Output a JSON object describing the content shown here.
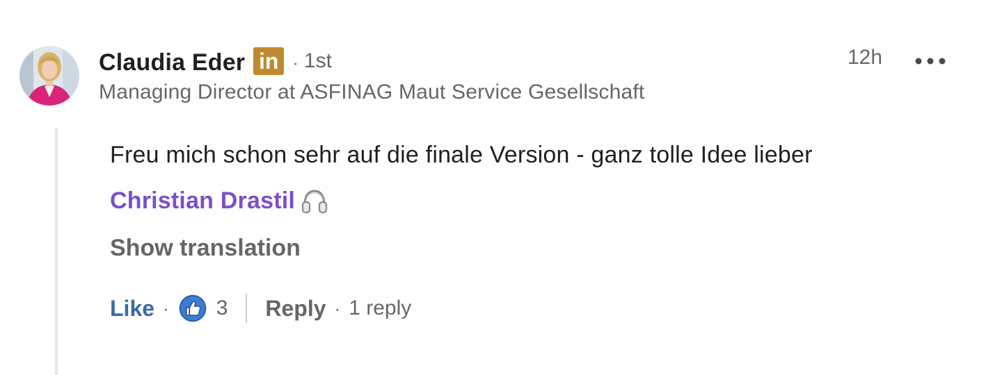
{
  "comment": {
    "author": {
      "name": "Claudia Eder",
      "badge_text": "in",
      "separator": "·",
      "connection_degree": "1st",
      "headline": "Managing Director at ASFINAG Maut Service Gesellschaft",
      "avatar_icon": "profile-photo"
    },
    "timestamp": "12h",
    "more_icon": "ellipsis-icon",
    "body": {
      "text_before_mention": "Freu mich schon sehr auf die finale Version - ganz tolle Idee lieber ",
      "mention": "Christian Drastil",
      "emoji": "headphone-emoji"
    },
    "show_translation_label": "Show translation",
    "actions": {
      "like_label": "Like",
      "separator": "·",
      "reaction_icon": "like-reaction-icon",
      "reaction_count": "3",
      "reply_label": "Reply",
      "reply_count_label": "1 reply"
    }
  },
  "colors": {
    "text_primary": "#1f1f1f",
    "text_secondary": "#666666",
    "mention": "#7b4fc9",
    "like_blue": "#3a6aa8",
    "badge_gold": "#c1892f",
    "thread_line": "#e8e8e8"
  }
}
